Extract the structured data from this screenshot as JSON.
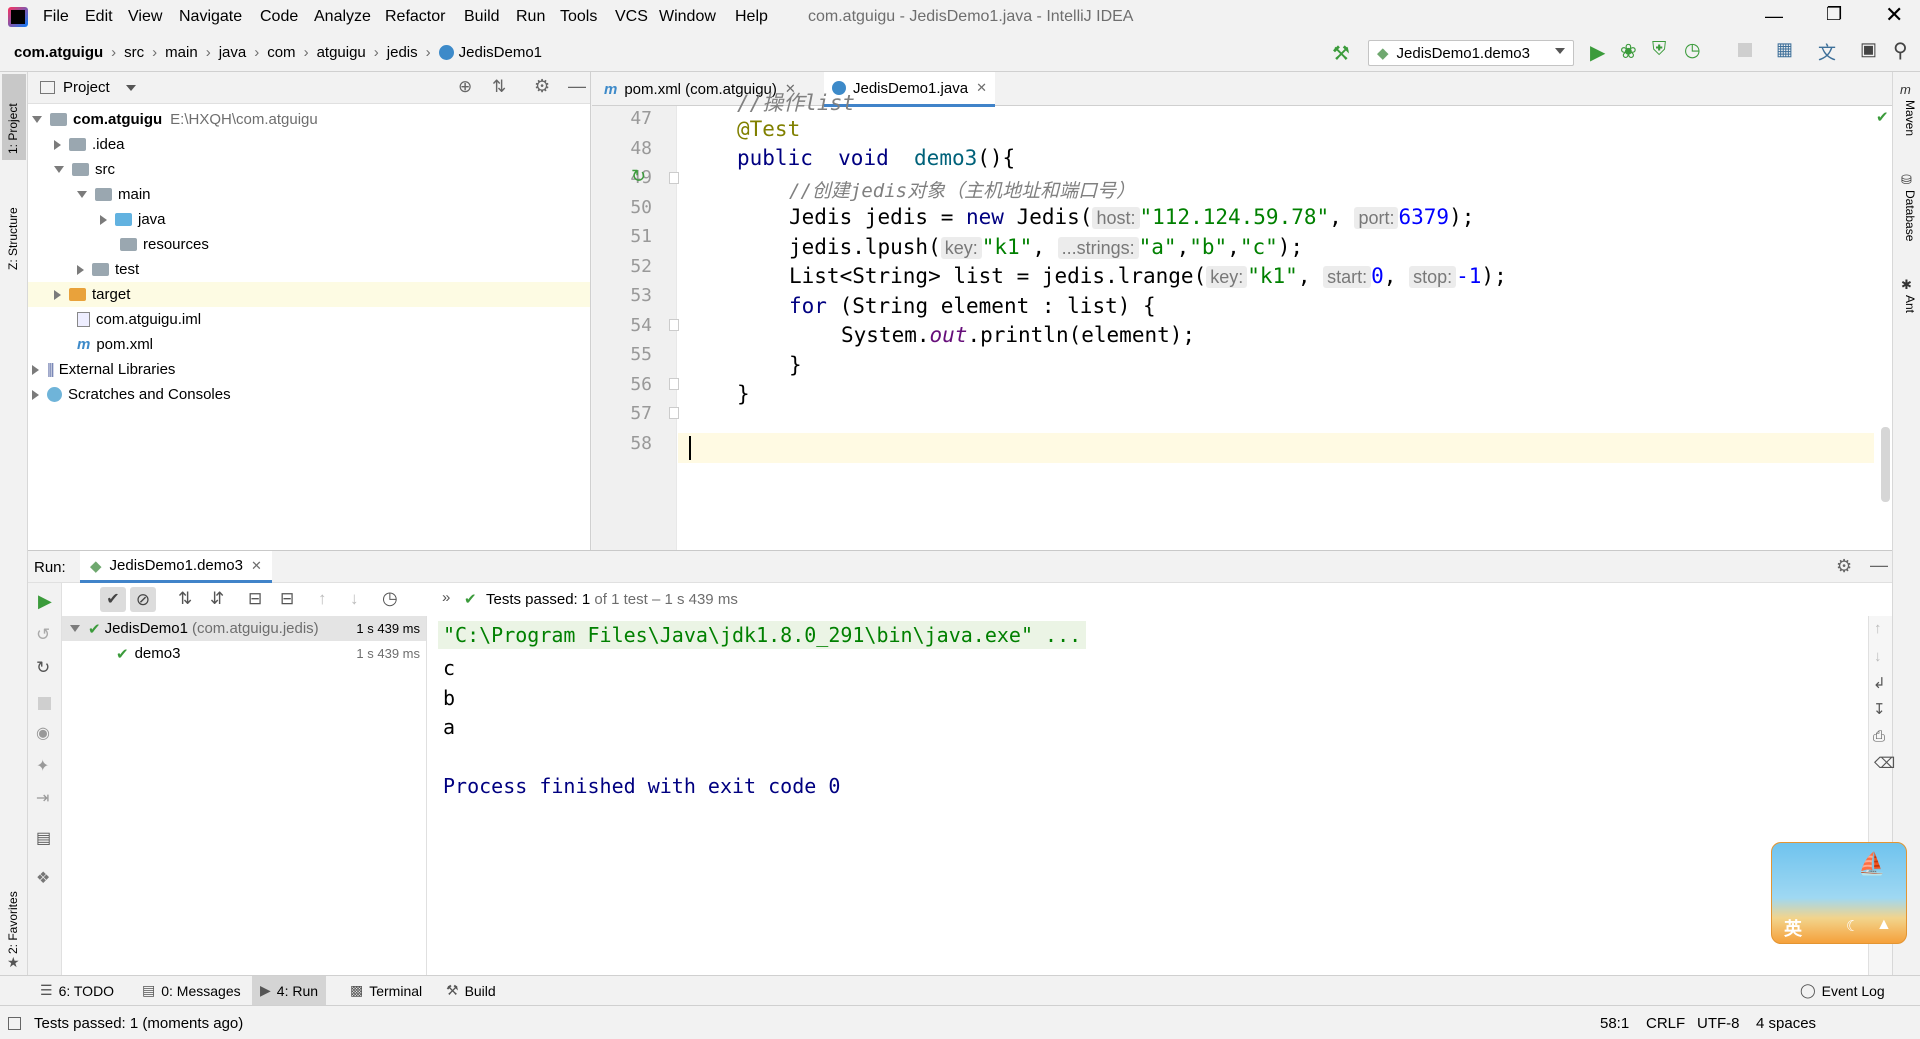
{
  "menu": {
    "items": [
      "File",
      "Edit",
      "View",
      "Navigate",
      "Code",
      "Analyze",
      "Refactor",
      "Build",
      "Run",
      "Tools",
      "VCS",
      "Window",
      "Help"
    ],
    "window_title": "com.atguigu - JedisDemo1.java - IntelliJ IDEA"
  },
  "breadcrumb": [
    "com.atguigu",
    "src",
    "main",
    "java",
    "com",
    "atguigu",
    "jedis",
    "JedisDemo1"
  ],
  "run_config": {
    "selected": "JedisDemo1.demo3"
  },
  "left_stripe": {
    "project": "1: Project",
    "structure": "Z: Structure",
    "favorites": "2: Favorites"
  },
  "right_stripe": {
    "maven": "Maven",
    "database": "Database",
    "ant": "Ant"
  },
  "project_panel": {
    "title": "Project",
    "tree": [
      {
        "label": "com.atguigu",
        "path": "E:\\HXQH\\com.atguigu"
      },
      {
        "label": ".idea"
      },
      {
        "label": "src"
      },
      {
        "label": "main"
      },
      {
        "label": "java"
      },
      {
        "label": "resources"
      },
      {
        "label": "test"
      },
      {
        "label": "target"
      },
      {
        "label": "com.atguigu.iml"
      },
      {
        "label": "pom.xml"
      },
      {
        "label": "External Libraries"
      },
      {
        "label": "Scratches and Consoles"
      }
    ]
  },
  "editor": {
    "tabs": [
      {
        "label": "pom.xml (com.atguigu)"
      },
      {
        "label": "JedisDemo1.java"
      }
    ],
    "lines": [
      {
        "n": "47"
      },
      {
        "n": "48"
      },
      {
        "n": "49"
      },
      {
        "n": "50"
      },
      {
        "n": "51"
      },
      {
        "n": "52"
      },
      {
        "n": "53"
      },
      {
        "n": "54"
      },
      {
        "n": "55"
      },
      {
        "n": "56"
      },
      {
        "n": "57"
      },
      {
        "n": "58"
      }
    ],
    "code": {
      "l47": "//操作list",
      "l48": "@Test",
      "l49_kw1": "public",
      "l49_kw2": "void",
      "l49_fn": "demo3",
      "l49_rest": "(){",
      "l50": "//创建jedis对象（主机地址和端口号）",
      "l51_a": "Jedis jedis = ",
      "l51_new": "new",
      "l51_b": " Jedis(",
      "l51_hint1": "host:",
      "l51_str": "\"112.124.59.78\"",
      "l51_c": ", ",
      "l51_hint2": "port:",
      "l51_num": "6379",
      "l51_d": ");",
      "l52_a": "jedis.lpush(",
      "l52_hint1": "key:",
      "l52_str1": "\"k1\"",
      "l52_b": ", ",
      "l52_hint2": "...strings:",
      "l52_str2": "\"a\"",
      "l52_c": ",",
      "l52_str3": "\"b\"",
      "l52_d": ",",
      "l52_str4": "\"c\"",
      "l52_e": ");",
      "l53_a": "List<String> list = jedis.lrange(",
      "l53_hint1": "key:",
      "l53_str": "\"k1\"",
      "l53_b": ", ",
      "l53_hint2": "start:",
      "l53_num1": "0",
      "l53_c": ", ",
      "l53_hint3": "stop:",
      "l53_num2": "-1",
      "l53_d": ");",
      "l54_kw": "for",
      "l54_rest": " (String element : list) {",
      "l55_a": "System.",
      "l55_out": "out",
      "l55_b": ".println(element);",
      "l56": "}",
      "l57": "}"
    }
  },
  "run_panel": {
    "label": "Run:",
    "tab": "JedisDemo1.demo3",
    "tests_passed_prefix": "Tests passed:",
    "tests_passed_count": "1",
    "tests_passed_suffix": "of 1 test – 1 s 439 ms",
    "tree": [
      {
        "label": "JedisDemo1",
        "pkg": "(com.atguigu.jedis)",
        "time": "1 s 439 ms"
      },
      {
        "label": "demo3",
        "time": "1 s 439 ms"
      }
    ],
    "console": {
      "cmd": "\"C:\\Program Files\\Java\\jdk1.8.0_291\\bin\\java.exe\" ...",
      "out1": "c",
      "out2": "b",
      "out3": "a",
      "finish": "Process finished with exit code 0"
    }
  },
  "tool_windows": {
    "todo": "6: TODO",
    "messages": "0: Messages",
    "run": "4: Run",
    "terminal": "Terminal",
    "build": "Build",
    "event_log": "Event Log"
  },
  "status_bar": {
    "message": "Tests passed: 1 (moments ago)",
    "position": "58:1",
    "line_sep": "CRLF",
    "encoding": "UTF-8",
    "indent": "4 spaces"
  },
  "overlay": {
    "ime_label": "英"
  },
  "colors": {
    "keyword": "#000080",
    "string": "#008000",
    "number": "#0000ff",
    "comment": "#808080",
    "annotation": "#808000",
    "run_green": "#3b9b3b",
    "console_blue": "#000080"
  }
}
